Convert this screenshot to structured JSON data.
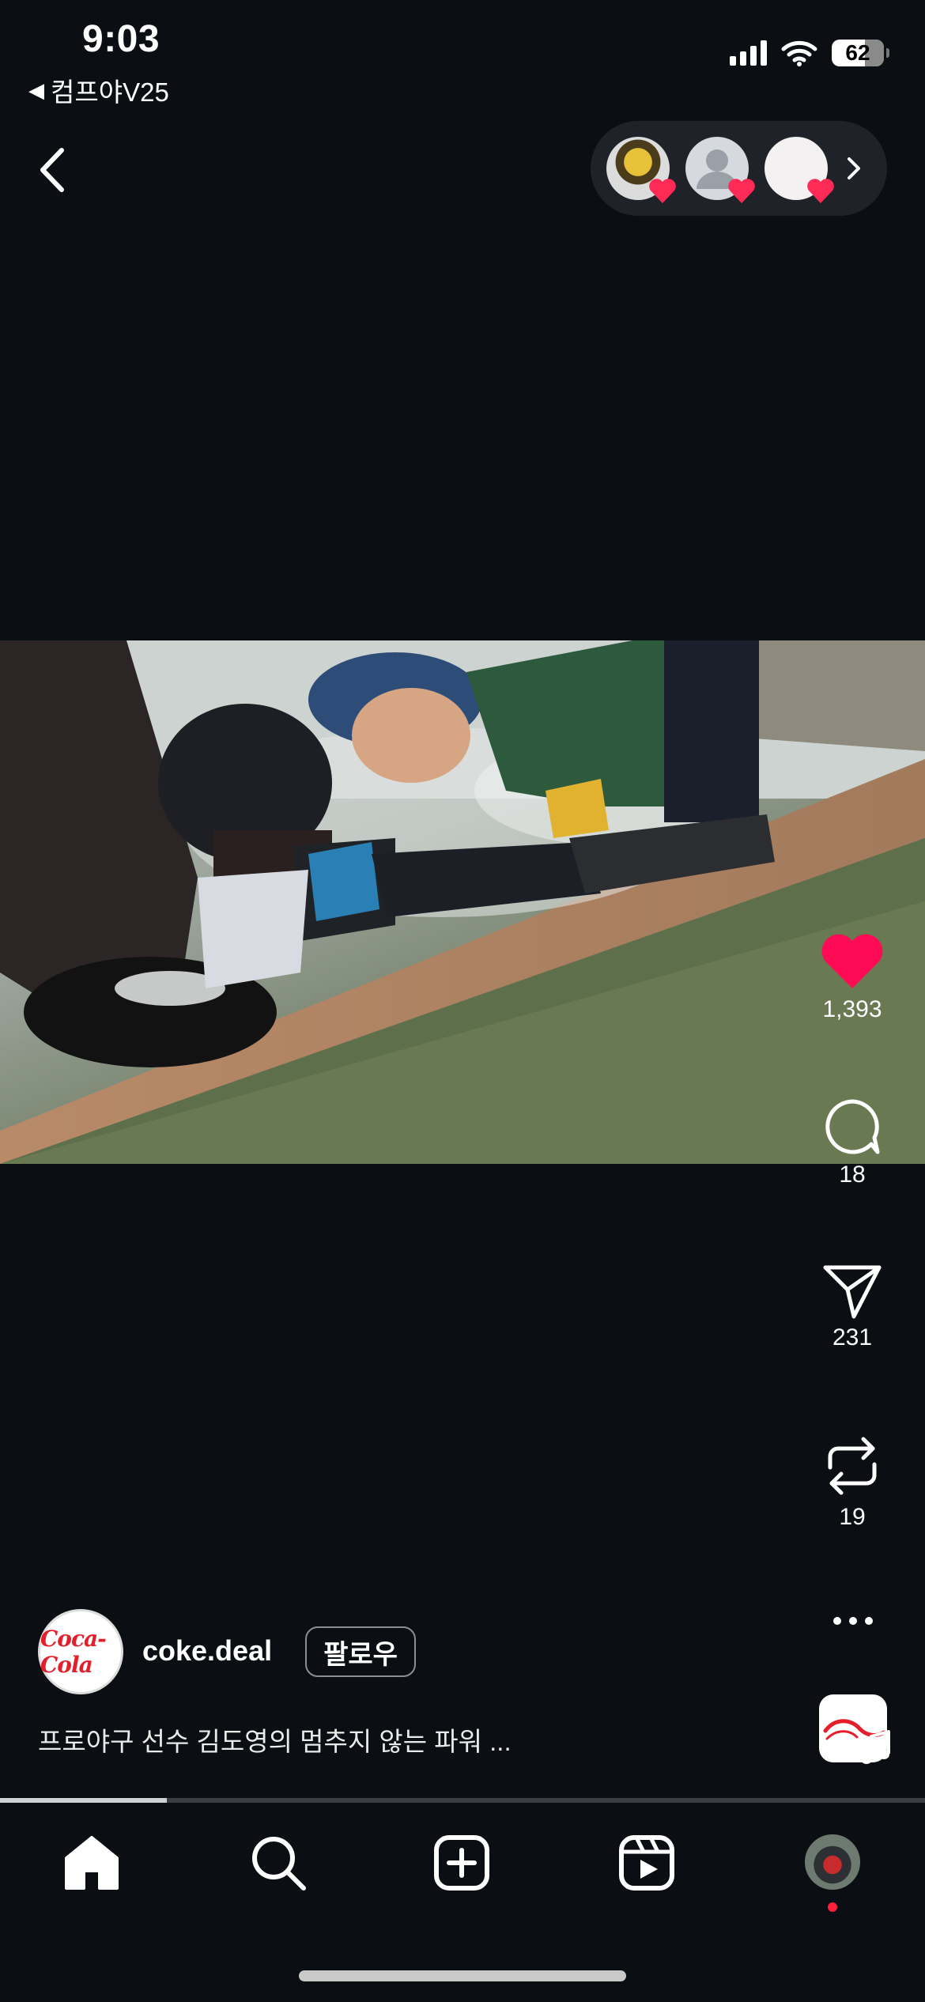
{
  "status_bar": {
    "time": "9:03",
    "back_app_label": "컴프야V25",
    "battery_level": "62"
  },
  "top": {
    "back_icon": "chevron-left-icon",
    "likers_expand_icon": "chevron-right-icon"
  },
  "actions": {
    "like_count": "1,393",
    "comment_count": "18",
    "share_count": "231",
    "repost_count": "19"
  },
  "post": {
    "username": "coke.deal",
    "follow_label": "팔로우",
    "caption": "프로야구 선수 김도영의 멈추지 않는 파워 ...",
    "avatar_logo_text": "Coca-Cola"
  },
  "playback": {
    "progress_fraction": 0.18
  },
  "colors": {
    "background": "#0b0e13",
    "like_active": "#ff0a54",
    "notification_dot": "#ff1f3d"
  },
  "tabs": [
    "home-icon",
    "search-icon",
    "create-icon",
    "reels-icon",
    "profile-avatar"
  ]
}
